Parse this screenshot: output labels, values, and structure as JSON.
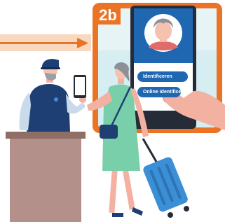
{
  "step": {
    "badge": "2b"
  },
  "phone_screen": {
    "buttons": [
      {
        "label": "Identificeren"
      },
      {
        "label": "Online identificeren"
      }
    ]
  },
  "colors": {
    "frame": "#ea7325",
    "arrow": "#ea7325",
    "arrow_band": "#f8d8bf",
    "phone_blue": "#1f67b1",
    "counter": "#b3918a",
    "counter_top": "#8f6e66",
    "officer_uniform": "#1e3f73",
    "dress": "#79cfa9",
    "suitcase": "#3b8fd6"
  }
}
